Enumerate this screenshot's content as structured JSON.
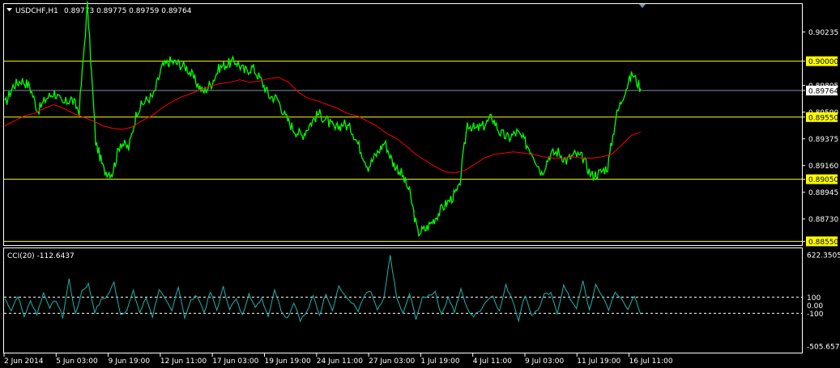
{
  "header": {
    "symbol": "USDCHF,H1",
    "ohlc": "0.89773 0.89775 0.89759 0.89764"
  },
  "colors": {
    "background": "#000000",
    "frame": "#ffffff",
    "price_line": "#00ff00",
    "moving_average": "#ff0000",
    "level_lines": "#ffff00",
    "current_price_line": "#7f8fa6",
    "cci_line": "#20b2aa",
    "cci_levels": "#ffffff"
  },
  "chart_data": [
    {
      "type": "line",
      "title": "USDCHF,H1",
      "ylim": [
        0.8852,
        0.9046
      ],
      "price_axis_ticks": [
        "0.90235",
        "0.90000",
        "0.89805",
        "0.89764",
        "0.89590",
        "0.89550",
        "0.89375",
        "0.89160",
        "0.89050",
        "0.88945",
        "0.88730",
        "0.88550"
      ],
      "horizontal_levels": [
        0.9,
        0.8955,
        0.8905,
        0.8855
      ],
      "level_labels": [
        "0.90000",
        "0.89550",
        "0.89050",
        "0.88550"
      ],
      "current_price": 0.89764,
      "current_price_label": "0.89764",
      "x_tick_labels": [
        "2 Jun 2014",
        "5 Jun 03:00",
        "9 Jun 19:00",
        "12 Jun 11:00",
        "17 Jun 03:00",
        "19 Jun 19:00",
        "24 Jun 11:00",
        "27 Jun 03:00",
        "1 Jul 19:00",
        "4 Jul 11:00",
        "9 Jul 03:00",
        "11 Jul 19:00",
        "16 Jul 11:00"
      ],
      "series": [
        {
          "values": [
            0.8965,
            0.898,
            0.8985,
            0.898,
            0.896,
            0.897,
            0.8975,
            0.8965,
            0.897,
            0.896,
            0.9045,
            0.8935,
            0.8912,
            0.891,
            0.8935,
            0.893,
            0.896,
            0.8968,
            0.8972,
            0.8995,
            0.9,
            0.8998,
            0.8995,
            0.8985,
            0.8975,
            0.8982,
            0.8995,
            0.8998,
            0.9,
            0.8992,
            0.8995,
            0.8985,
            0.8972,
            0.897,
            0.8955,
            0.8945,
            0.894,
            0.895,
            0.8958,
            0.8952,
            0.8945,
            0.895,
            0.8945,
            0.893,
            0.8915,
            0.8925,
            0.8935,
            0.8918,
            0.891,
            0.8895,
            0.8862,
            0.8865,
            0.8873,
            0.8882,
            0.8889,
            0.8897,
            0.895,
            0.8945,
            0.8948,
            0.8955,
            0.8942,
            0.8938,
            0.8943,
            0.8935,
            0.8925,
            0.891,
            0.8925,
            0.8927,
            0.892,
            0.8925,
            0.8922,
            0.8908,
            0.891,
            0.8915,
            0.8955,
            0.8975,
            0.899,
            0.8978
          ]
        },
        {
          "values": [
            0.8948,
            0.8952,
            0.8956,
            0.8958,
            0.8962,
            0.8965,
            0.8962,
            0.8958,
            0.8955,
            0.8952,
            0.8948,
            0.8946,
            0.8945,
            0.8947,
            0.8952,
            0.8956,
            0.8962,
            0.8967,
            0.8971,
            0.8974,
            0.8977,
            0.898,
            0.8982,
            0.8983,
            0.8985,
            0.8983,
            0.8984,
            0.8986,
            0.8987,
            0.8983,
            0.8975,
            0.897,
            0.8968,
            0.8965,
            0.8962,
            0.8958,
            0.8956,
            0.8952,
            0.8948,
            0.8942,
            0.8938,
            0.8932,
            0.8925,
            0.892,
            0.8915,
            0.8911,
            0.891,
            0.8912,
            0.8917,
            0.8922,
            0.8925,
            0.8926,
            0.8927,
            0.8926,
            0.8925,
            0.8923,
            0.8922,
            0.8922,
            0.8923,
            0.8922,
            0.8922,
            0.8923,
            0.8925,
            0.8932,
            0.894,
            0.8943
          ]
        }
      ]
    },
    {
      "type": "line",
      "title": "CCI(20) -112.6437",
      "ylim": [
        -505.6573,
        622.3505
      ],
      "levels": [
        100,
        0,
        -100
      ],
      "axis_labels": [
        "622.3505",
        "100",
        "0.00",
        "-100",
        "-505.6573"
      ],
      "series": [
        {
          "values": [
            80,
            -60,
            120,
            -140,
            50,
            -110,
            150,
            -20,
            60,
            -150,
            320,
            -120,
            180,
            260,
            -80,
            60,
            120,
            280,
            -110,
            -60,
            170,
            -90,
            90,
            -140,
            200,
            60,
            -80,
            240,
            -150,
            60,
            120,
            -90,
            160,
            -60,
            220,
            -40,
            70,
            -130,
            160,
            -40,
            90,
            -140,
            200,
            -60,
            -160,
            40,
            -180,
            -90,
            110,
            -120,
            150,
            -60,
            240,
            100,
            40,
            -80,
            120,
            170,
            -70,
            70,
            620,
            90,
            -110,
            140,
            -160,
            80,
            120,
            170,
            -130,
            110,
            -80,
            190,
            -50,
            -140,
            -60,
            60,
            120,
            -80,
            240,
            80,
            -180,
            130,
            -120,
            -60,
            130,
            140,
            -90,
            240,
            80,
            -30,
            290,
            -60,
            240,
            120,
            -50,
            150,
            80,
            -40,
            100,
            -113
          ]
        }
      ]
    }
  ]
}
